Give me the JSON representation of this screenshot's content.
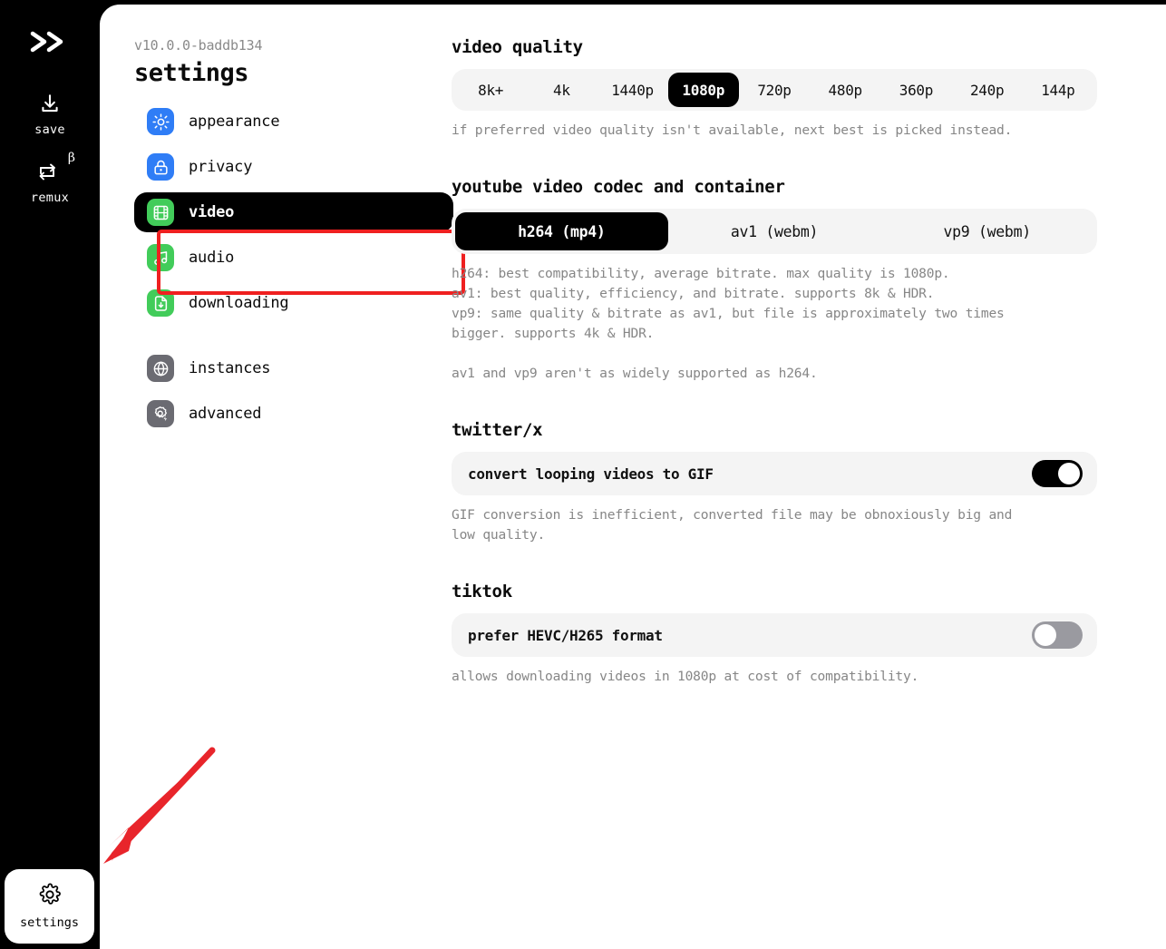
{
  "rail": {
    "logo": "chevrons-right-icon",
    "items": [
      {
        "id": "save",
        "label": "save",
        "icon": "download-icon",
        "badge": ""
      },
      {
        "id": "remux",
        "label": "remux",
        "icon": "loop-arrows-icon",
        "badge": "β"
      }
    ],
    "bottom": {
      "label": "settings",
      "icon": "gear-icon"
    }
  },
  "nav": {
    "version": "v10.0.0-baddb134",
    "title": "settings",
    "items": [
      {
        "label": "appearance",
        "icon": "sun-icon",
        "color": "blue",
        "active": false
      },
      {
        "label": "privacy",
        "icon": "lock-icon",
        "color": "blue",
        "active": false
      },
      {
        "label": "video",
        "icon": "film-icon",
        "color": "green",
        "active": true
      },
      {
        "label": "audio",
        "icon": "music-note-icon",
        "color": "green",
        "active": false
      },
      {
        "label": "downloading",
        "icon": "file-download-icon",
        "color": "green",
        "active": false
      },
      {
        "label": "instances",
        "icon": "globe-icon",
        "color": "grey",
        "active": false
      },
      {
        "label": "advanced",
        "icon": "gear-bolt-icon",
        "color": "grey",
        "active": false
      }
    ]
  },
  "main": {
    "quality": {
      "title": "video quality",
      "options": [
        "8k+",
        "4k",
        "1440p",
        "1080p",
        "720p",
        "480p",
        "360p",
        "240p",
        "144p"
      ],
      "selected": "1080p",
      "description": "if preferred video quality isn't available, next best is picked instead."
    },
    "codec": {
      "title": "youtube video codec and container",
      "options": [
        "h264 (mp4)",
        "av1 (webm)",
        "vp9 (webm)"
      ],
      "selected": "h264 (mp4)",
      "description": "h264: best compatibility, average bitrate. max quality is 1080p.\nav1: best quality, efficiency, and bitrate. supports 8k & HDR.\nvp9: same quality & bitrate as av1, but file is approximately two times\nbigger. supports 4k & HDR.\n\nav1 and vp9 aren't as widely supported as h264."
    },
    "twitter": {
      "title": "twitter/x",
      "toggle_label": "convert looping videos to GIF",
      "toggle_state": "on",
      "description": "GIF conversion is inefficient, converted file may be obnoxiously big and\nlow quality."
    },
    "tiktok": {
      "title": "tiktok",
      "toggle_label": "prefer HEVC/H265 format",
      "toggle_state": "off",
      "description": "allows downloading videos in 1080p at cost of compatibility."
    }
  },
  "annotations": {
    "highlight_color": "#ef2020",
    "arrow_color": "#e8252b",
    "highlight_target": "video",
    "arrow_target": "settings"
  }
}
